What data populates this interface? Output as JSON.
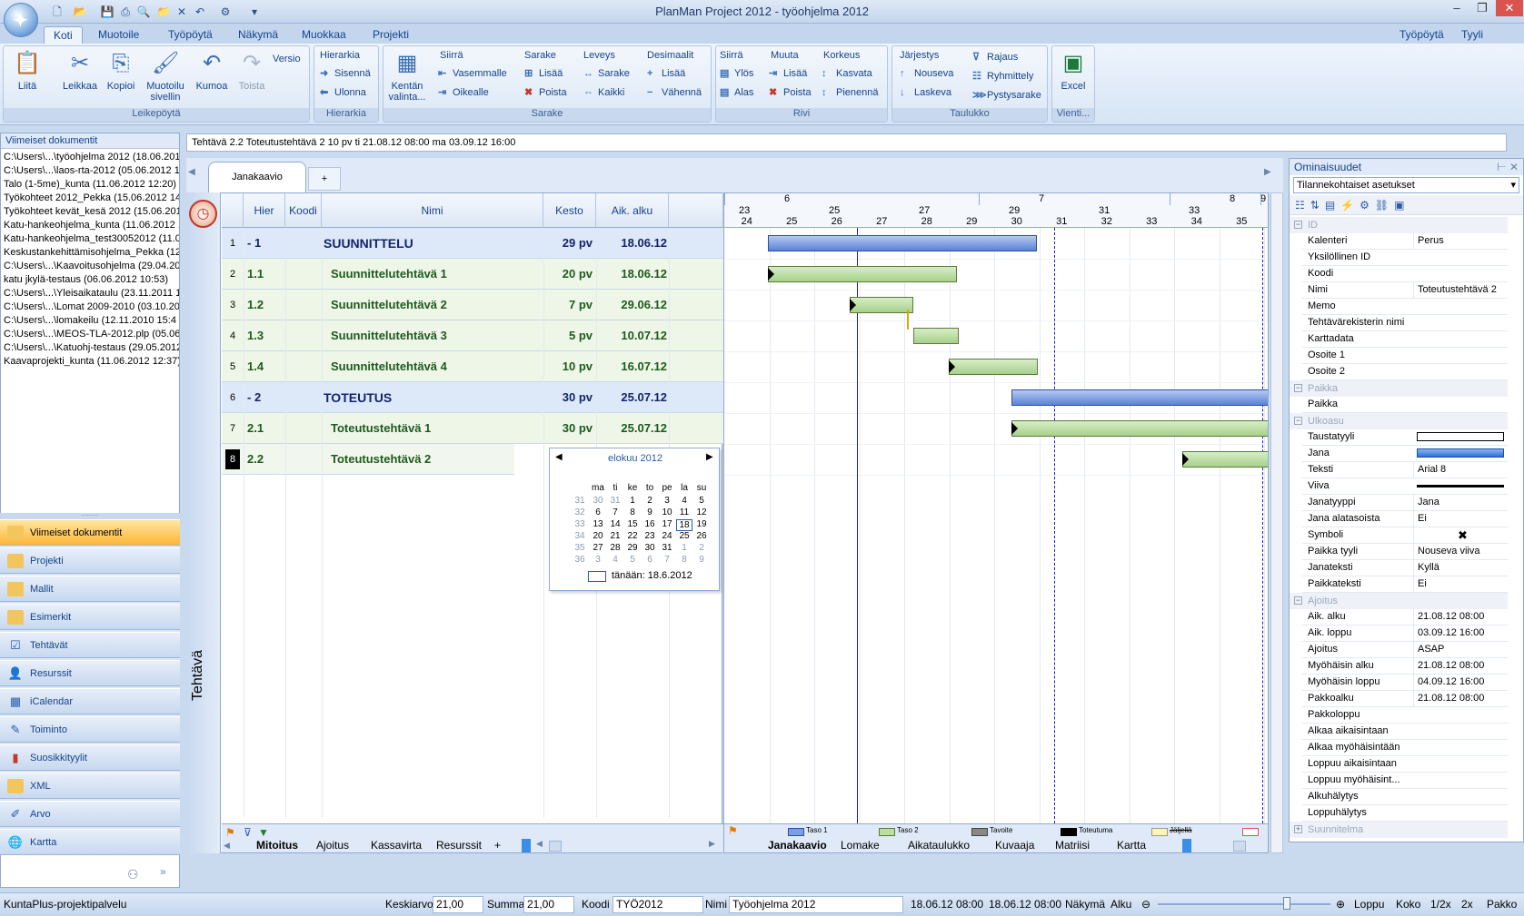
{
  "window": {
    "title": "PlanMan Project 2012 - työohjelma 2012",
    "controls": [
      "–",
      "❐",
      "✕"
    ]
  },
  "ribbon_tabs": [
    "Koti",
    "Muotoile",
    "Työpöytä",
    "Näkymä",
    "Muokkaa",
    "Projekti"
  ],
  "ribbon_right": {
    "workspace": "Työpöytä",
    "style": "Tyyli"
  },
  "ribbon": {
    "clipboard": {
      "label": "Leikepöytä",
      "paste": "Liitä",
      "cut": "Leikkaa",
      "copy": "Kopioi",
      "format_painter": "Muotoilu sivellin",
      "undo": "Kumoa",
      "redo": "Toista",
      "version": "Versio"
    },
    "hierarchy": {
      "label": "Hierarkia",
      "head": "Hierarkia",
      "indent": "Sisennä",
      "outdent": "Ulonna"
    },
    "column": {
      "label": "Sarake",
      "field_select": "Kentän valinta...",
      "move_head": "Siirrä",
      "move_left": "Vasemmalle",
      "move_right": "Oikealle",
      "col_head": "Sarake",
      "col_add": "Lisää",
      "col_del": "Poista",
      "width_head": "Leveys",
      "width_col": "Sarake",
      "width_all": "Kaikki",
      "dec_head": "Desimaalit",
      "dec_add": "Lisää",
      "dec_sub": "Vähennä"
    },
    "row": {
      "label": "Rivi",
      "move_head": "Siirrä",
      "up": "Ylös",
      "down": "Alas",
      "change_head": "Muuta",
      "add": "Lisää",
      "del": "Poista",
      "height_head": "Korkeus",
      "grow": "Kasvata",
      "shrink": "Pienennä"
    },
    "table": {
      "label": "Taulukko",
      "sort_head": "Järjestys",
      "asc": "Nouseva",
      "desc": "Laskeva",
      "filter": "Rajaus",
      "group": "Ryhmittely",
      "vcol": "Pystysarake"
    },
    "export": {
      "label": "Vienti...",
      "excel": "Excel"
    }
  },
  "recent": {
    "title": "Viimeiset dokumentit",
    "items": [
      "C:\\Users\\...\\työohjelma 2012 (18.06.2012",
      "C:\\Users\\...\\laos-rta-2012 (05.06.2012 13:",
      "Talo (1-5me)_kunta (11.06.2012 12:20)",
      "Työkohteet 2012_Pekka (15.06.2012 14:",
      "Työkohteet kevät_kesä 2012 (15.06.201",
      "Katu-hankeohjelma_kunta (11.06.2012 1",
      "Katu-hankeohjelma_test30052012 (11.06",
      "Keskustankehittämisohjelma_Pekka (12.0",
      "C:\\Users\\...\\Kaavoitusohjelma (29.04.201",
      "katu jkylä-testaus (06.06.2012 10:53)",
      "C:\\Users\\...\\Yleisaikataulu (23.11.2011 15",
      "C:\\Users\\...\\Lomat 2009-2010 (03.10.201",
      "C:\\Users\\...\\lomakeilu (12.11.2010 15:4",
      "C:\\Users\\...\\MEOS-TLA-2012.plp (05.06.2",
      "C:\\Users\\...\\Katuohj-testaus (29.05.2012",
      "Kaavaprojekti_kunta (11.06.2012 12:37)"
    ]
  },
  "nav": [
    "Viimeiset dokumentit",
    "Projekti",
    "Mallit",
    "Esimerkit",
    "Tehtävät",
    "Resurssit",
    "iCalendar",
    "Toiminto",
    "Suosikkityylit",
    "XML",
    "Arvo",
    "Kartta"
  ],
  "info_bar": "Tehtävä 2.2  Toteutustehtävä 2   10 pv  ti 21.08.12 08:00  ma 03.09.12 16:00",
  "view_tab": "Janakaavio",
  "view_tab_plus": "+",
  "side_label": "Tehtävä",
  "grid": {
    "headers": [
      "Hier",
      "Koodi",
      "Nimi",
      "Kesto",
      "Aik. alku"
    ],
    "rows": [
      {
        "n": "1",
        "hier": "- 1",
        "name": "SUUNNITTELU",
        "dur": "29 pv",
        "start": "18.06.12"
      },
      {
        "n": "2",
        "hier": "1.1",
        "name": "Suunnittelutehtävä 1",
        "dur": "20 pv",
        "start": "18.06.12"
      },
      {
        "n": "3",
        "hier": "1.2",
        "name": "Suunnittelutehtävä 2",
        "dur": "7 pv",
        "start": "29.06.12"
      },
      {
        "n": "4",
        "hier": "1.3",
        "name": "Suunnittelutehtävä 3",
        "dur": "5 pv",
        "start": "10.07.12"
      },
      {
        "n": "5",
        "hier": "1.4",
        "name": "Suunnittelutehtävä 4",
        "dur": "10 pv",
        "start": "16.07.12"
      },
      {
        "n": "6",
        "hier": "- 2",
        "name": "TOTEUTUS",
        "dur": "30 pv",
        "start": "25.07.12"
      },
      {
        "n": "7",
        "hier": "2.1",
        "name": "Toteutustehtävä 1",
        "dur": "30 pv",
        "start": "25.07.12"
      },
      {
        "n": "8",
        "hier": "2.2",
        "name": "Toteutustehtävä 2",
        "dur": "",
        "start": ""
      }
    ]
  },
  "calendar": {
    "month": "elokuu 2012",
    "days": [
      "ma",
      "ti",
      "ke",
      "to",
      "pe",
      "la",
      "su"
    ],
    "weeks": [
      [
        "31",
        "30",
        "31",
        "1",
        "2",
        "3",
        "4",
        "5"
      ],
      [
        "32",
        "6",
        "7",
        "8",
        "9",
        "10",
        "11",
        "12"
      ],
      [
        "33",
        "13",
        "14",
        "15",
        "16",
        "17",
        "18",
        "19"
      ],
      [
        "34",
        "20",
        "21",
        "22",
        "23",
        "24",
        "25",
        "26"
      ],
      [
        "35",
        "27",
        "28",
        "29",
        "30",
        "31",
        "1",
        "2"
      ],
      [
        "36",
        "3",
        "4",
        "5",
        "6",
        "7",
        "8",
        "9"
      ]
    ],
    "today": "tänään: 18.6.2012"
  },
  "gantt": {
    "months": [
      {
        "label": "6"
      },
      {
        "label": "7"
      },
      {
        "label": "8"
      },
      {
        "label": "9"
      }
    ],
    "weeks_top": [
      "23",
      "25",
      "27",
      "29",
      "31",
      "33",
      "35"
    ],
    "weeks_bottom": [
      "24",
      "25",
      "26",
      "27",
      "28",
      "29",
      "30",
      "31",
      "32",
      "33",
      "34",
      "35",
      "3"
    ]
  },
  "bottom_tabs_left": [
    "Mitoitus",
    "Ajoitus",
    "Kassavirta",
    "Resurssit",
    "+"
  ],
  "bottom_tabs_right": [
    "Janakaavio",
    "Lomake",
    "Aikataulukko",
    "Kuvaaja",
    "Matriisi",
    "Kartta"
  ],
  "legend": [
    "Taso 1",
    "Taso 2",
    "Tavoite",
    "Toteutuma",
    "Jäljellä"
  ],
  "props": {
    "title": "Ominaisuudet",
    "select": "Tilannekohtaiset asetukset",
    "rows": [
      {
        "cat": "ID"
      },
      {
        "k": "Kalenteri",
        "v": "Perus"
      },
      {
        "k": "Yksilöllinen ID",
        "v": ""
      },
      {
        "k": "Koodi",
        "v": ""
      },
      {
        "k": "Nimi",
        "v": "Toteutustehtävä 2"
      },
      {
        "k": "Memo",
        "v": ""
      },
      {
        "k": "Tehtävärekisterin nimi",
        "v": ""
      },
      {
        "k": "Karttadata",
        "v": ""
      },
      {
        "k": "Osoite 1",
        "v": ""
      },
      {
        "k": "Osoite 2",
        "v": ""
      },
      {
        "cat": "Paikka"
      },
      {
        "k": "Paikka",
        "v": ""
      },
      {
        "cat": "Ulkoasu"
      },
      {
        "k": "Taustatyyli",
        "v": ""
      },
      {
        "k": "Jana",
        "v": ""
      },
      {
        "k": "Teksti",
        "v": "Arial 8"
      },
      {
        "k": "Viiva",
        "v": ""
      },
      {
        "k": "Janatyyppi",
        "v": "Jana"
      },
      {
        "k": "Jana alatasoista",
        "v": "Ei"
      },
      {
        "k": "Symboli",
        "v": "✖"
      },
      {
        "k": "Paikka tyyli",
        "v": "Nouseva viiva"
      },
      {
        "k": "Janateksti",
        "v": "Kyllä"
      },
      {
        "k": "Paikkateksti",
        "v": "Ei"
      },
      {
        "cat": "Ajoitus"
      },
      {
        "k": "Aik. alku",
        "v": "21.08.12 08:00"
      },
      {
        "k": "Aik. loppu",
        "v": "03.09.12 16:00"
      },
      {
        "k": "Ajoitus",
        "v": "ASAP"
      },
      {
        "k": "Myöhäisin alku",
        "v": "21.08.12 08:00"
      },
      {
        "k": "Myöhäisin loppu",
        "v": "04.09.12 16:00"
      },
      {
        "k": "Pakkoalku",
        "v": "21.08.12 08:00"
      },
      {
        "k": "Pakkoloppu",
        "v": ""
      },
      {
        "k": "Alkaa aikaisintaan",
        "v": ""
      },
      {
        "k": "Alkaa myöhäisintään",
        "v": ""
      },
      {
        "k": "Loppuu aikaisintaan",
        "v": ""
      },
      {
        "k": "Loppuu myöhäisint...",
        "v": ""
      },
      {
        "k": "Alkuhälytys",
        "v": ""
      },
      {
        "k": "Loppuhälytys",
        "v": ""
      },
      {
        "cat": "Suunnitelma"
      }
    ]
  },
  "status": {
    "left": "KuntaPlus-projektipalvelu",
    "avg_label": "Keskiarvo",
    "avg": "21,00",
    "sum_label": "Summa",
    "sum": "21,00",
    "code_label": "Koodi",
    "code": "TYÖ2012",
    "name_label": "Nimi",
    "name": "Työohjelma 2012",
    "start": "18.06.12 08:00",
    "end": "18.06.12 08:00",
    "view": "Näkymä",
    "begin": "Alku",
    "finish": "Loppu",
    "zoom": [
      "Koko",
      "1/2x",
      "2x",
      "Pakko"
    ]
  }
}
